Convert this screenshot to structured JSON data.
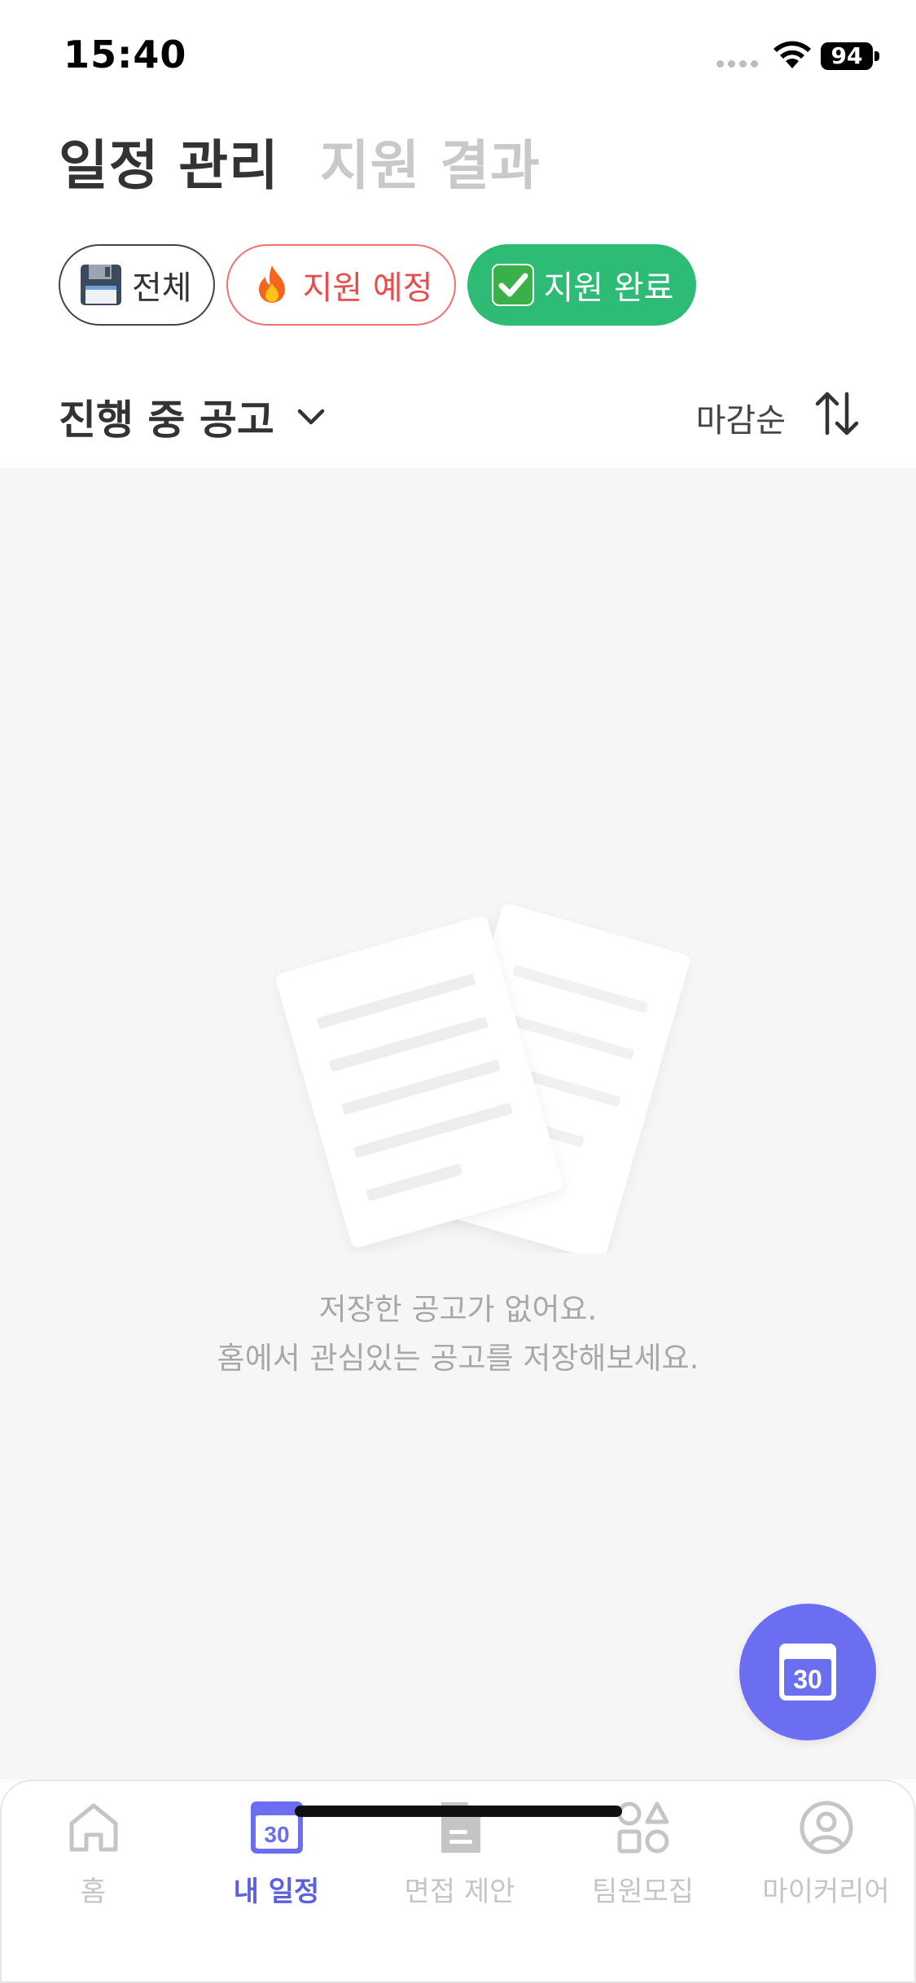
{
  "status_bar": {
    "time": "15:40",
    "battery": "94"
  },
  "header": {
    "tabs": [
      {
        "label": "일정 관리",
        "active": true
      },
      {
        "label": "지원 결과",
        "active": false
      }
    ]
  },
  "filters": {
    "all": {
      "label": "전체",
      "icon": "floppy-disk-icon"
    },
    "planned": {
      "label": "지원 예정",
      "icon": "fire-icon"
    },
    "done": {
      "label": "지원 완료",
      "icon": "check-box-icon"
    }
  },
  "section": {
    "title": "진행 중 공고",
    "sort_label": "마감순"
  },
  "empty_state": {
    "line1": "저장한 공고가 없어요.",
    "line2": "홈에서 관심있는 공고를 저장해보세요."
  },
  "fab": {
    "icon": "calendar-icon",
    "day": "30"
  },
  "bottom_nav": {
    "items": [
      {
        "label": "홈",
        "icon": "home-icon",
        "active": false
      },
      {
        "label": "내 일정",
        "icon": "calendar-icon",
        "active": true,
        "day": "30"
      },
      {
        "label": "면접 제안",
        "icon": "document-icon",
        "active": false
      },
      {
        "label": "팀원모집",
        "icon": "shapes-icon",
        "active": false
      },
      {
        "label": "마이커리어",
        "icon": "user-circle-icon",
        "active": false
      }
    ]
  },
  "colors": {
    "primary": "#6b6ef0",
    "done_green": "#2dbb75",
    "planned_red": "#e84d4d",
    "background": "#f6f6f6"
  }
}
